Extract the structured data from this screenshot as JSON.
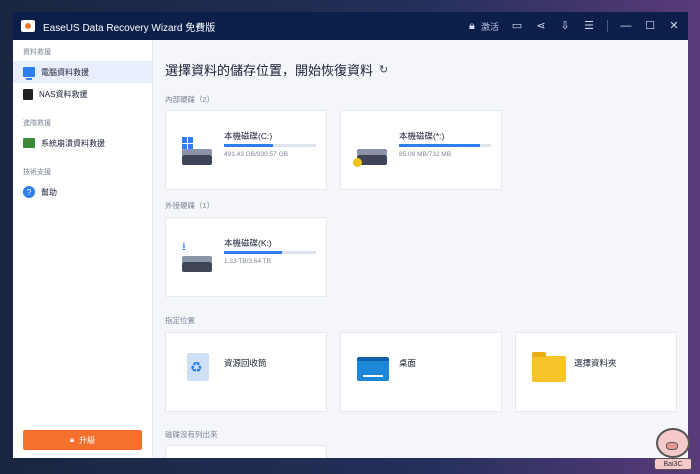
{
  "window": {
    "title": "EaseUS Data Recovery Wizard 免費版",
    "activate_label": "激活"
  },
  "sidebar": {
    "sections": [
      {
        "label": "資料救援",
        "items": [
          {
            "label": "電腦資料救援",
            "icon": "computer-icon",
            "active": true
          },
          {
            "label": "NAS資料救援",
            "icon": "nas-icon",
            "active": false
          }
        ]
      },
      {
        "label": "進階救援",
        "items": [
          {
            "label": "系統崩潰資料救援",
            "icon": "crash-recovery-icon",
            "active": false
          }
        ]
      },
      {
        "label": "技術支援",
        "items": [
          {
            "label": "幫助",
            "icon": "help-icon",
            "active": false
          }
        ]
      }
    ],
    "upgrade_label": "升級"
  },
  "main": {
    "title": "選擇資料的儲存位置，開始恢復資料",
    "internal_label": "內部硬碟（2）",
    "external_label": "外接硬碟（1）",
    "specified_label": "指定位置",
    "missing_label": "磁碟沒有列出來",
    "internal_drives": [
      {
        "name": "本機磁碟(C:)",
        "size": "491.43 GB/930.57 GB",
        "used_fraction": 0.53,
        "icon": "windows-drive-icon"
      },
      {
        "name": "本機磁碟(*:)",
        "size": "85.09 MB/732 MB",
        "used_fraction": 0.88,
        "icon": "locked-drive-icon"
      }
    ],
    "external_drives": [
      {
        "name": "本機磁碟(K:)",
        "size": "1.33 TB/3.64 TB",
        "used_fraction": 0.63,
        "icon": "usb-drive-icon"
      }
    ],
    "locations": [
      {
        "name": "資源回收筒",
        "icon": "recycle-bin-icon"
      },
      {
        "name": "桌面",
        "icon": "desktop-icon"
      },
      {
        "name": "選擇資料夾",
        "icon": "folder-icon"
      }
    ]
  },
  "watermark": {
    "label": "Bai3C"
  },
  "colors": {
    "titlebar": "#0b1f4a",
    "accent": "#2d7ef0",
    "upgrade": "#f4702c"
  }
}
